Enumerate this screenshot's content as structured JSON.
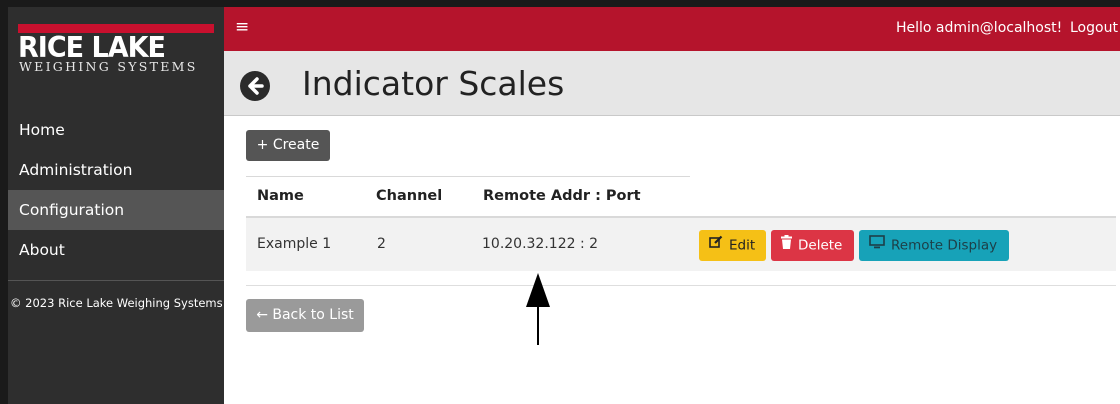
{
  "brand": {
    "name": "RICE LAKE",
    "subtitle": "WEIGHING SYSTEMS",
    "accent_color": "#c8102e"
  },
  "sidebar": {
    "items": [
      {
        "label": "Home",
        "active": false
      },
      {
        "label": "Administration",
        "active": false
      },
      {
        "label": "Configuration",
        "active": true
      },
      {
        "label": "About",
        "active": false
      }
    ],
    "copyright": "© 2023 Rice Lake Weighing Systems"
  },
  "topbar": {
    "menu_icon": "≡",
    "greeting": "Hello admin@localhost!",
    "logout": "Logout",
    "color": "#b5142c"
  },
  "page": {
    "back_icon": "back-arrow-circle-icon",
    "title": "Indicator Scales",
    "create_button": "+ Create",
    "back_to_list": "← Back to List"
  },
  "table": {
    "columns": [
      "Name",
      "Channel",
      "Remote Addr : Port"
    ],
    "rows": [
      {
        "name": "Example 1",
        "channel": "2",
        "remote": "10.20.32.122 : 2"
      }
    ],
    "actions": {
      "edit": "Edit",
      "delete": "Delete",
      "remote_display": "Remote Display"
    }
  }
}
